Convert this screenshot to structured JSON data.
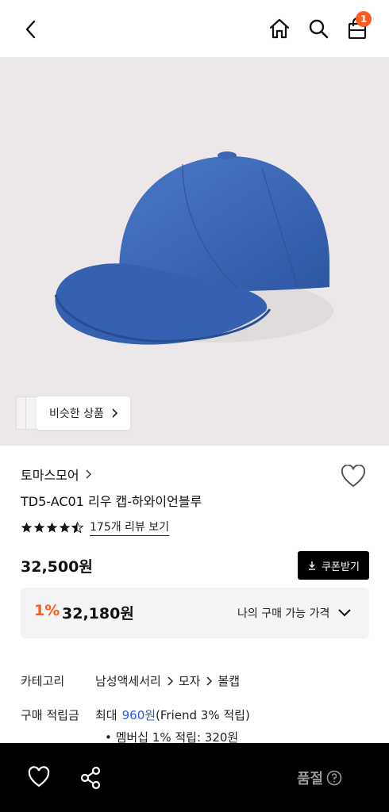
{
  "header": {
    "back_icon": "chevron-left-icon",
    "home_icon": "home-icon",
    "search_icon": "search-icon",
    "bag_icon": "shopping-bag-icon",
    "bag_badge": "1",
    "badge_color": "#ff5a1f"
  },
  "hero": {
    "similar_label": "비슷한 상품"
  },
  "product": {
    "brand": "토마스모어",
    "title": "TD5-AC01 리우 캡-하와이언블루",
    "rating": 4.5,
    "review_link": "175개 리뷰 보기",
    "price": "32,500원",
    "coupon_label": "쿠폰받기"
  },
  "my_price": {
    "discount": "1%",
    "price": "32,180원",
    "label": "나의 구매 가능 가격"
  },
  "details": {
    "category_label": "카테고리",
    "category_path": [
      "남성액세서리",
      "모자",
      "볼캡"
    ],
    "points_label": "구매 적립금",
    "points_prefix": "최대",
    "points_amount": "960원",
    "points_suffix": "(Friend 3% 적립)",
    "membership": "멤버십 1% 적립: 320원"
  },
  "bottom_bar": {
    "soldout_label": "품절",
    "soldout_help_icon": "question-circle-icon",
    "like_icon": "heart-outline-icon",
    "share_icon": "share-icon"
  },
  "colors": {
    "accent": "#ff5a1f",
    "link_blue": "#2a5bd7",
    "cap_blue": "#3c68b8"
  }
}
